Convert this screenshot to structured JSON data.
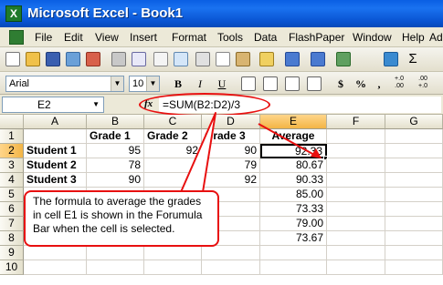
{
  "window": {
    "app_icon": "X",
    "title": "Microsoft Excel - Book1"
  },
  "menu": [
    "File",
    "Edit",
    "View",
    "Insert",
    "Format",
    "Tools",
    "Data",
    "FlashPaper",
    "Window",
    "Help",
    "Ado"
  ],
  "format_toolbar": {
    "font": "Arial",
    "size": "10",
    "bold": "B",
    "italic": "I",
    "underline": "U",
    "currency": "$",
    "percent": "%",
    "comma": ",",
    "inc_decimal": "+.0\n.00",
    "dec_decimal": ".00\n+.0"
  },
  "formula_bar": {
    "name_box": "E2",
    "fx_label": "fx",
    "formula": "=SUM(B2:D2)/3"
  },
  "columns": [
    "A",
    "B",
    "C",
    "D",
    "E",
    "F",
    "G"
  ],
  "rows": [
    "1",
    "2",
    "3",
    "4",
    "5",
    "6",
    "7",
    "8",
    "9",
    "10"
  ],
  "cells": {
    "b1": "Grade 1",
    "c1": "Grade 2",
    "d1": "Grade 3",
    "e1": "Average",
    "a2": "Student 1",
    "b2": "95",
    "c2": "92",
    "d2": "90",
    "e2": "92.33",
    "a3": "Student 2",
    "b3": "78",
    "d3": "79",
    "e3": "80.67",
    "a4": "Student 3",
    "b4": "90",
    "d4": "92",
    "e4": "90.33",
    "e5": "85.00",
    "e6": "73.33",
    "e7": "79.00",
    "e8": "73.67"
  },
  "callout": "The formula to average the grades in cell E1 is shown in the Forumula Bar when the cell is selected.",
  "colors": {
    "title_bar": "#0a5fe3",
    "annotation_red": "#e81010",
    "header_active": "#f3b546"
  }
}
